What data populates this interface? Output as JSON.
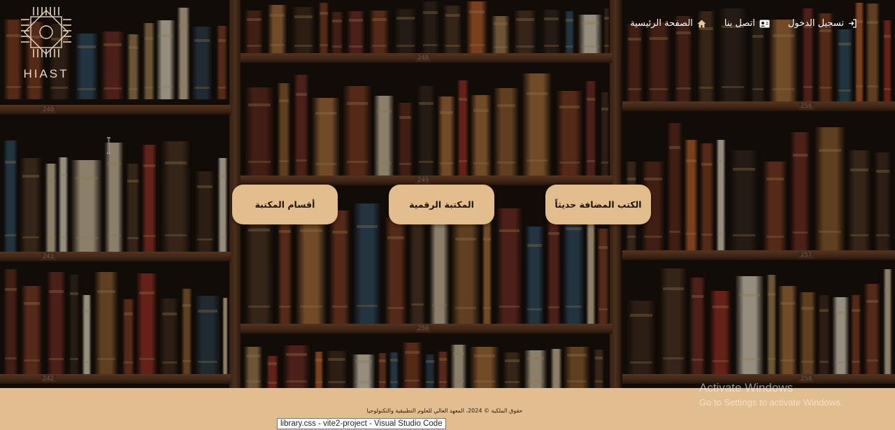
{
  "brand": {
    "name": "HIAST",
    "accent": "#e2bd8e"
  },
  "nav": {
    "login": {
      "label": "تسجيل الدخول",
      "icon": "login-icon"
    },
    "contact": {
      "label": "اتصل بنا",
      "icon": "contact-card-icon"
    },
    "home": {
      "label": "الصفحة الرئيسية",
      "icon": "home-icon"
    }
  },
  "actions": {
    "new_books": "الكتب المضافة حديثاً",
    "digital_library": "المكتبة الرقمية",
    "library_sections": "أقسام المكتبة"
  },
  "shelf_numbers": [
    "240",
    "241",
    "242",
    "248",
    "249",
    "250",
    "256",
    "257",
    "258"
  ],
  "footer": {
    "copyright": "حقوق الملكية © 2024، المعهد العالي للعلوم التطبيقية والتكنولوجيا"
  },
  "os_watermark": {
    "title": "Activate Windows",
    "subtitle": "Go to Settings to activate Windows."
  },
  "taskbar_tooltip": "library.css - vite2-project - Visual Studio Code"
}
